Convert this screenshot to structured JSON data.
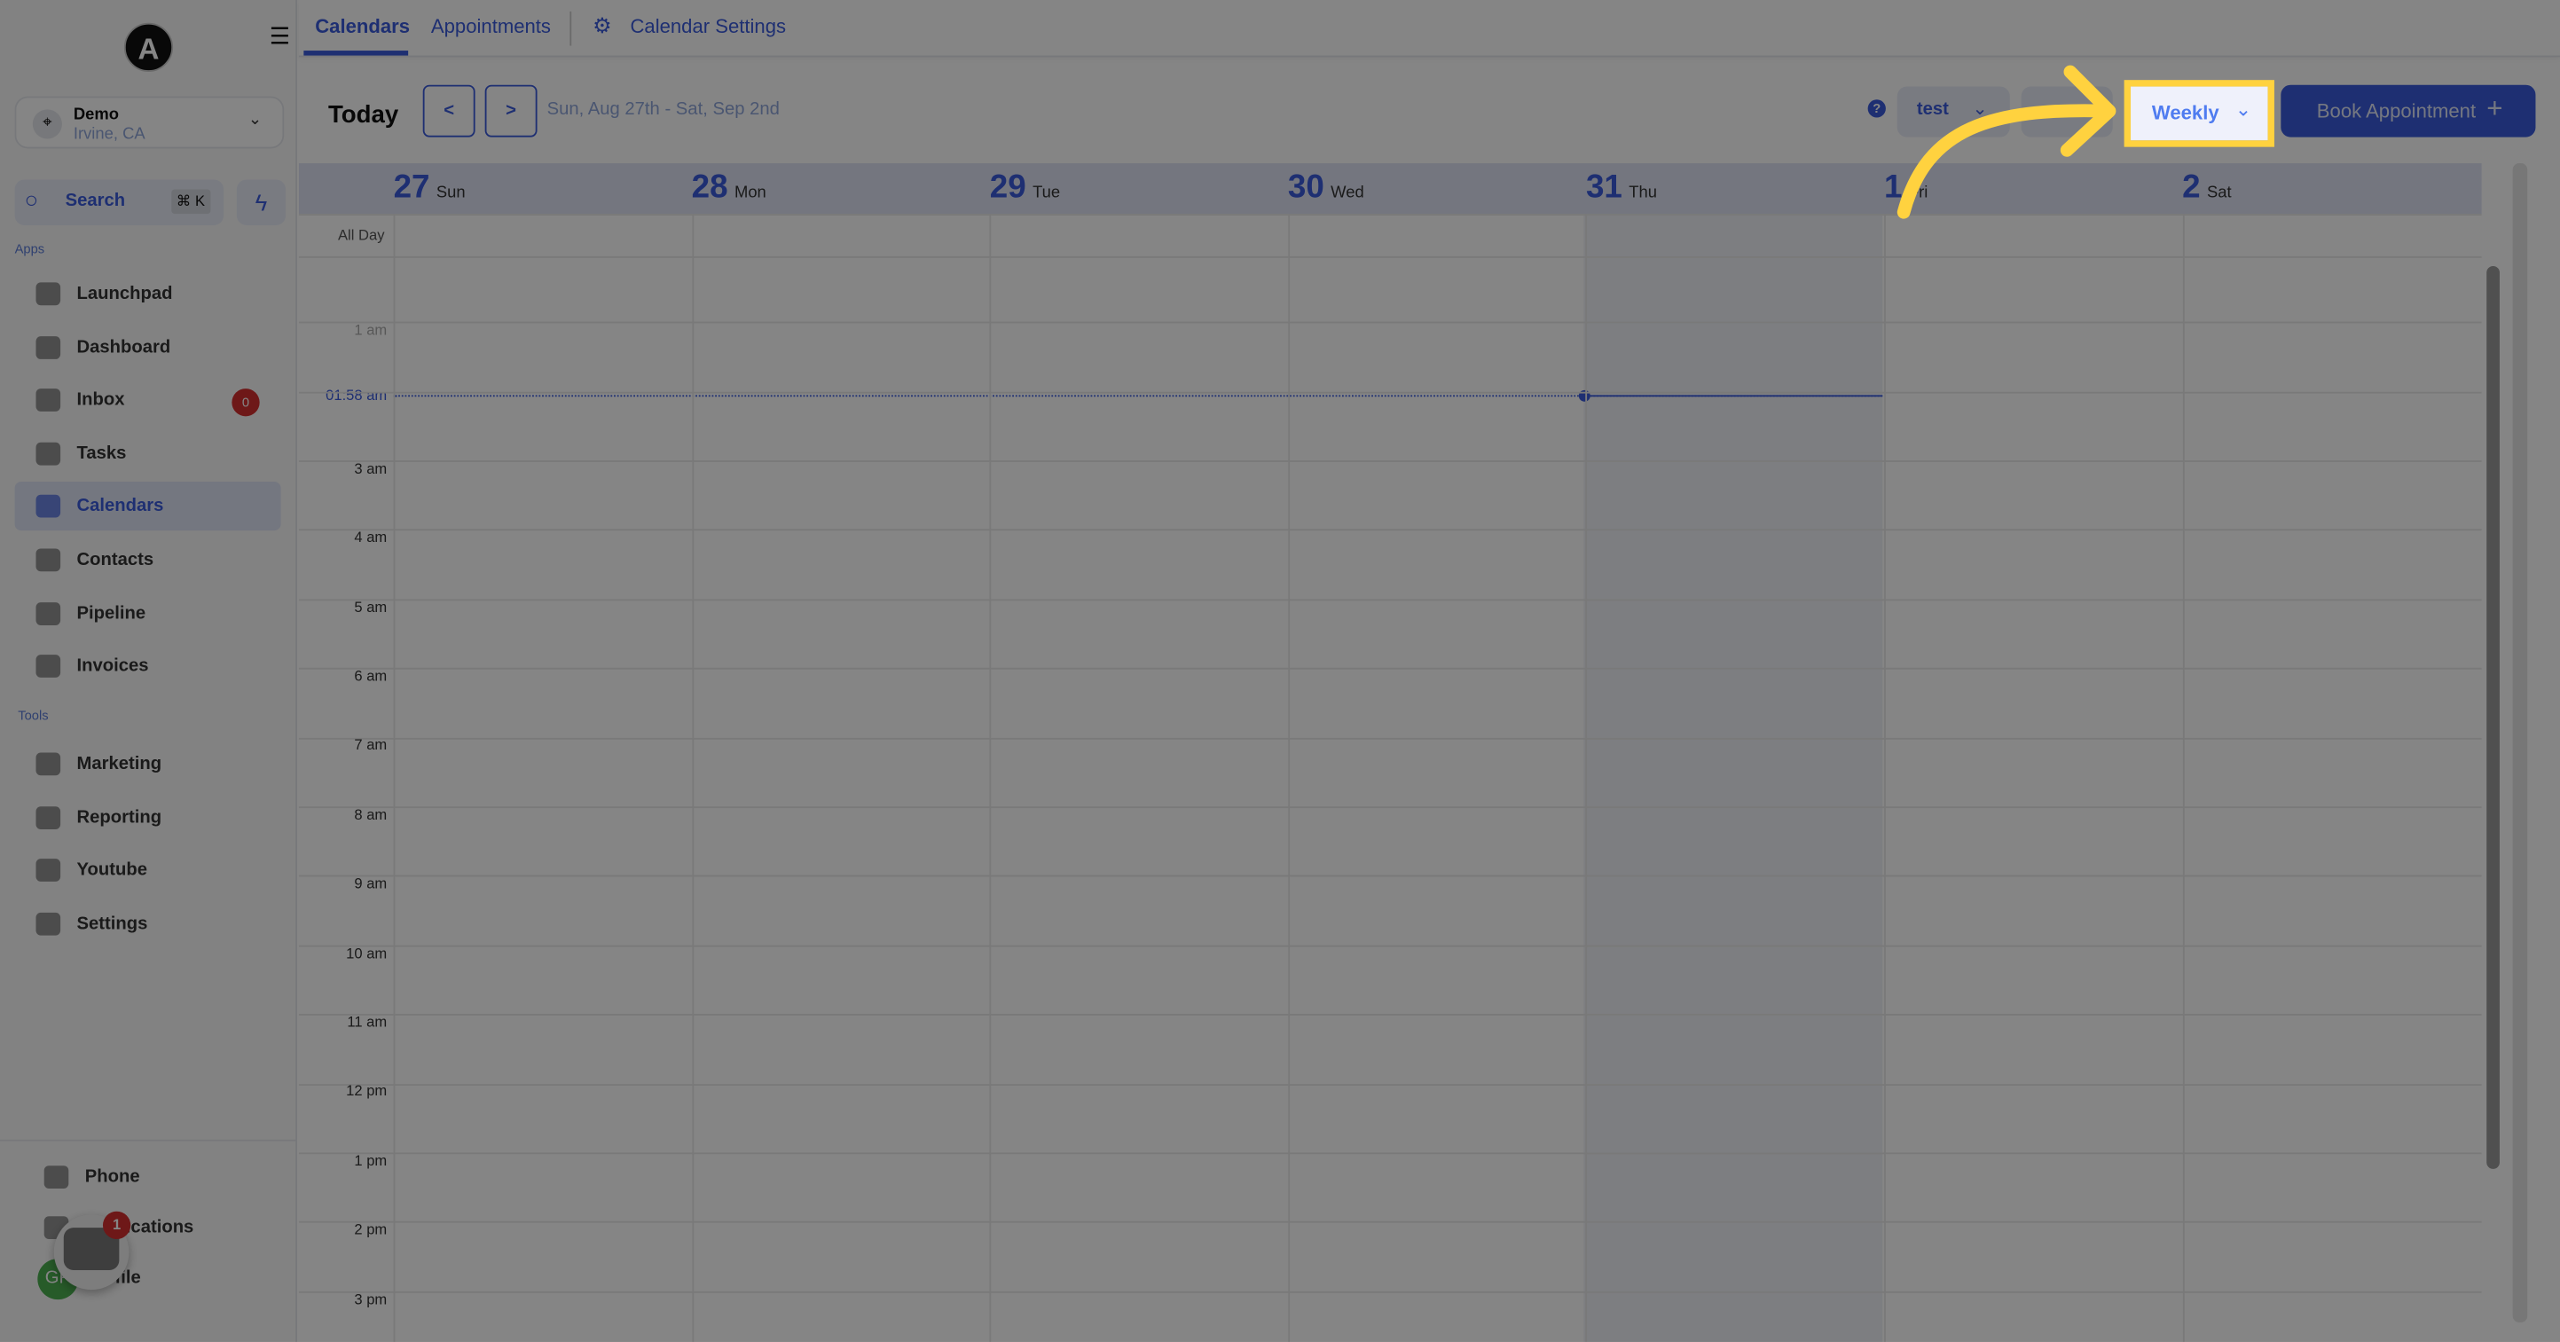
{
  "sidebar": {
    "logo": "A",
    "location": {
      "name": "Demo",
      "sub": "Irvine, CA"
    },
    "search": {
      "label": "Search",
      "shortcut": "⌘ K"
    },
    "apps_label": "Apps",
    "tools_label": "Tools",
    "apps": [
      {
        "label": "Launchpad"
      },
      {
        "label": "Dashboard"
      },
      {
        "label": "Inbox",
        "badge": "0"
      },
      {
        "label": "Tasks"
      },
      {
        "label": "Calendars",
        "active": true
      },
      {
        "label": "Contacts"
      },
      {
        "label": "Pipeline"
      },
      {
        "label": "Invoices"
      }
    ],
    "tools": [
      {
        "label": "Marketing"
      },
      {
        "label": "Reporting"
      },
      {
        "label": "Youtube"
      },
      {
        "label": "Settings"
      }
    ],
    "bottom": [
      {
        "label": "Phone"
      },
      {
        "label": "Notifications"
      },
      {
        "label": "Profile"
      }
    ],
    "chat_badge": "1",
    "avatar": "GP"
  },
  "tabs": [
    {
      "label": "Calendars",
      "active": true
    },
    {
      "label": "Appointments"
    },
    {
      "label": "Calendar Settings",
      "icon": "gear-icon"
    }
  ],
  "toolbar": {
    "today": "Today",
    "prev": "<",
    "next": ">",
    "range": "Sun, Aug 27th - Sat, Sep 2nd",
    "help": "?",
    "calendar_select": "test",
    "view_select": "Weekly",
    "book": "Book Appointment",
    "book_icon": "+"
  },
  "days": [
    {
      "num": "27",
      "name": "Sun"
    },
    {
      "num": "28",
      "name": "Mon"
    },
    {
      "num": "29",
      "name": "Tue"
    },
    {
      "num": "30",
      "name": "Wed"
    },
    {
      "num": "31",
      "name": "Thu",
      "today": true
    },
    {
      "num": "1",
      "name": "Fri"
    },
    {
      "num": "2",
      "name": "Sat"
    }
  ],
  "all_day": "All Day",
  "current_time": "01:58 am",
  "times": [
    "1 am",
    "3 am",
    "4 am",
    "5 am",
    "6 am",
    "7 am",
    "8 am",
    "9 am",
    "10 am",
    "11 am",
    "12 pm",
    "1 pm",
    "2 pm",
    "3 pm"
  ],
  "colors": {
    "accent": "#3b5bdb",
    "highlight": "#ffd23f"
  }
}
